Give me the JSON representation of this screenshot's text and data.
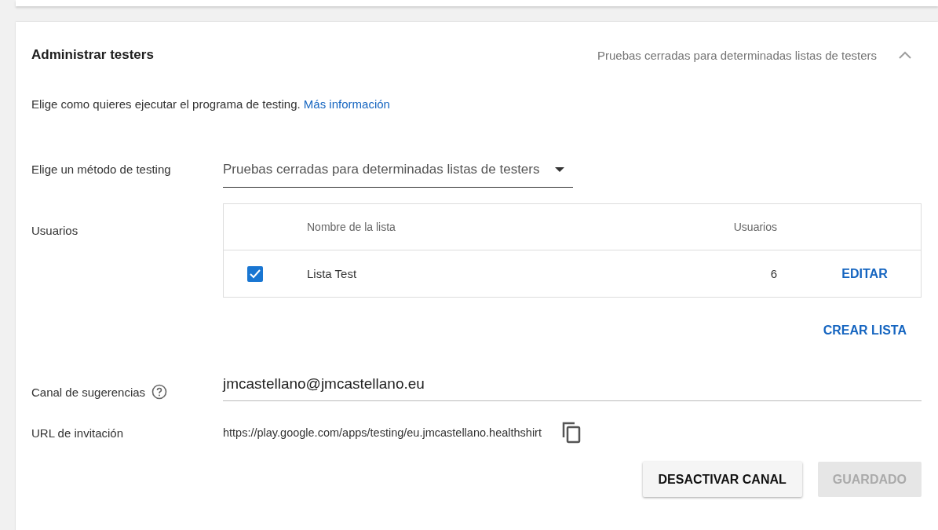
{
  "section": {
    "title": "Administrar testers",
    "summary": "Pruebas cerradas para determinadas listas de testers",
    "expanded": true
  },
  "description": {
    "text": "Elige como quieres ejecutar el programa de testing.",
    "link": "Más información"
  },
  "method": {
    "label": "Elige un método de testing",
    "value": "Pruebas cerradas para determinadas listas de testers"
  },
  "users": {
    "label": "Usuarios",
    "columns": [
      "Nombre de la lista",
      "Usuarios"
    ],
    "rows": [
      {
        "checked": true,
        "name": "Lista Test",
        "count": "6",
        "action": "EDITAR"
      }
    ],
    "create_button": "CREAR LISTA"
  },
  "feedback": {
    "label": "Canal de sugerencias",
    "value": "jmcastellano@jmcastellano.eu"
  },
  "invite": {
    "label": "URL de invitación",
    "url": "https://play.google.com/apps/testing/eu.jmcastellano.healthshirt"
  },
  "buttons": [
    {
      "label": "DESACTIVAR CANAL",
      "disabled": false
    },
    {
      "label": "GUARDADO",
      "disabled": true
    }
  ]
}
